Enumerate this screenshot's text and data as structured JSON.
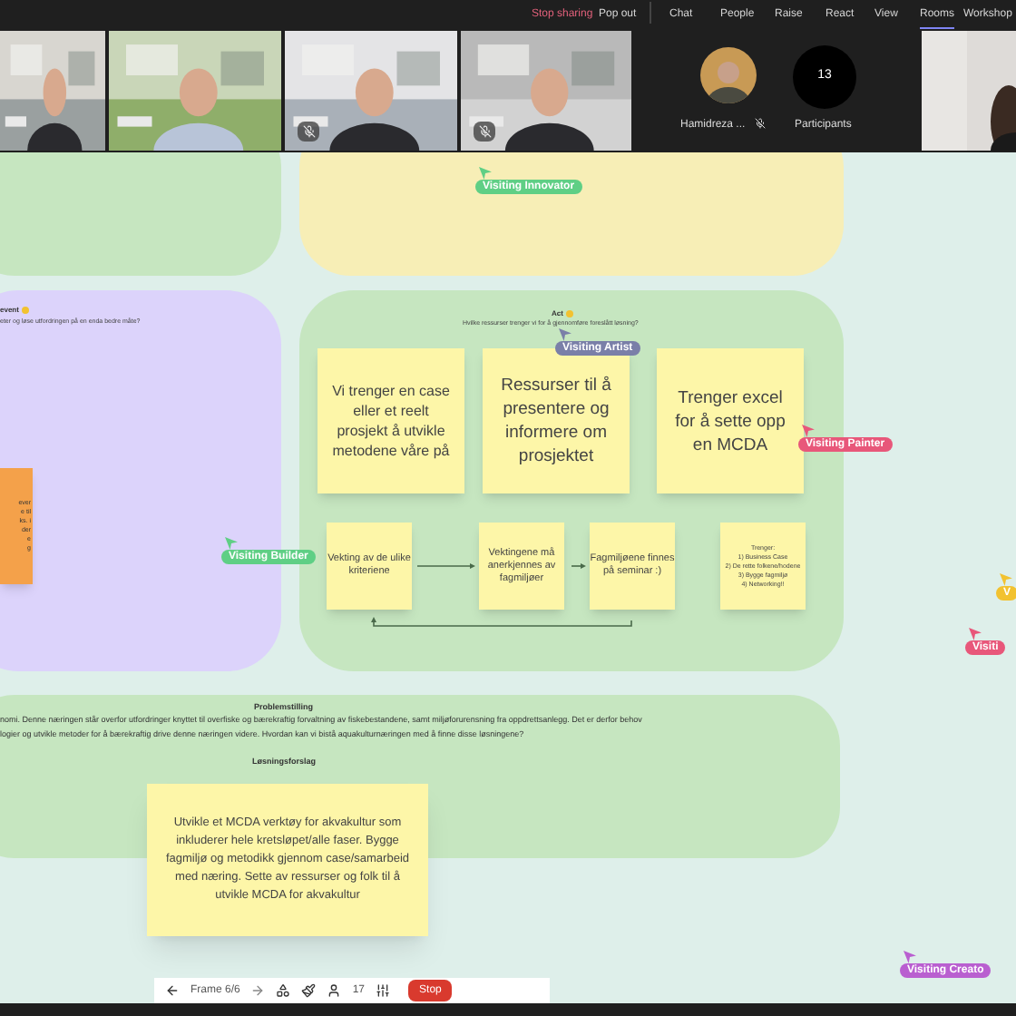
{
  "top_bar": {
    "stop_sharing": "Stop sharing",
    "pop_out": "Pop out",
    "items": [
      {
        "label": "Chat",
        "selected": false
      },
      {
        "label": "People",
        "selected": false
      },
      {
        "label": "Raise",
        "selected": false
      },
      {
        "label": "React",
        "selected": false
      },
      {
        "label": "View",
        "selected": false
      },
      {
        "label": "Rooms",
        "selected": true
      },
      {
        "label": "Workshop",
        "selected": false
      }
    ]
  },
  "videos": [
    {
      "kind": "picture",
      "muted": false
    },
    {
      "kind": "picture",
      "muted": false
    },
    {
      "kind": "picture",
      "muted": true
    },
    {
      "kind": "picture",
      "muted": true
    }
  ],
  "participant": {
    "name": "Hamidreza ...",
    "muted": true
  },
  "participants": {
    "count": "13",
    "label": "Participants"
  },
  "whiteboard": {
    "purple_area": {
      "title": "event",
      "question": "eter og løse utfordringen på en enda bedre måte?",
      "orange_note": [
        "ever",
        "e til",
        "ks. i",
        "der",
        "e",
        "g"
      ]
    },
    "act_area": {
      "title": "Act",
      "question": "Hvilke ressurser trenger vi for å gjennomføre foreslått løsning?",
      "big_notes": [
        "Vi trenger en case eller et reelt prosjekt å utvikle metodene våre på",
        "Ressurser til å presentere og informere om prosjektet",
        "Trenger excel for å sette opp en MCDA"
      ],
      "small_notes": [
        "Vekting av de ulike kriteriene",
        "Vektingene må anerkjennes av fagmiljøer",
        "Fagmiljøene finnes på seminar :)",
        "Trenger:\n1) Business Case\n2) De rette folkene/hodene\n3) Bygge fagmiljø\n4) Networking!!"
      ]
    },
    "problem_area": {
      "heading": "Problemstilling",
      "text": [
        "nomi. Denne næringen står overfor utfordringer knyttet til overfiske og bærekraftig forvaltning av fiskebestandene, samt miljøforurensning fra oppdrettsanlegg. Det er derfor behov",
        "logier og utvikle metoder for å bærekraftig drive denne næringen videre. Hvordan kan vi bistå aquakulturnæringen med å finne disse løsningene?"
      ],
      "solution_heading": "Løsningsforslag",
      "solution_note": "Utvikle et MCDA verktøy for akvakultur som inkluderer hele kretsløpet/alle faser. Bygge fagmiljø og metodikk gjennom case/samarbeid med næring. Sette av ressurser og folk til å utvikle MCDA for akvakultur"
    },
    "cursors": [
      {
        "label": "Visiting Innovator",
        "color": "#5fcf85"
      },
      {
        "label": "Visiting Artist",
        "color": "#7a7fa8"
      },
      {
        "label": "Visiting Painter",
        "color": "#e8577a"
      },
      {
        "label": "Visiting Builder",
        "color": "#5fcf85"
      },
      {
        "label": "V",
        "color": "#f2c230"
      },
      {
        "label": "Visiti",
        "color": "#e8577a"
      },
      {
        "label": "Visiting Creato",
        "color": "#b95fd0"
      }
    ]
  },
  "frame_toolbar": {
    "frame": "Frame 6/6",
    "count": "17",
    "stop": "Stop"
  }
}
